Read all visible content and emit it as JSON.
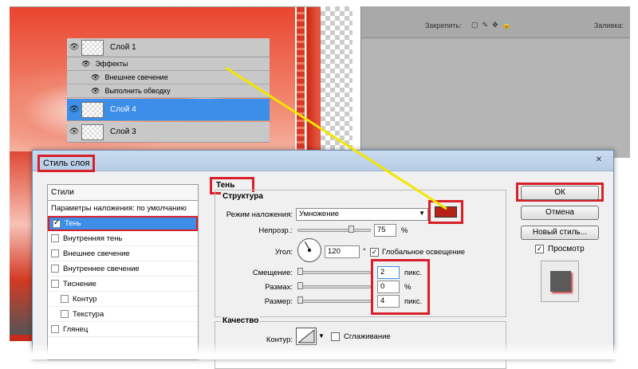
{
  "layers_panel": {
    "lock_label": "Закрепить:",
    "fill_label": "Заливка:",
    "layers": [
      {
        "name": "Слой 1",
        "visible": true
      },
      {
        "name": "Эффекты",
        "kind": "effects-header"
      },
      {
        "name": "Внешнее свечение",
        "kind": "effect"
      },
      {
        "name": "Выполнить обводку",
        "kind": "effect"
      },
      {
        "name": "Слой 4",
        "selected": true
      },
      {
        "name": "Слой 3"
      }
    ]
  },
  "dialog": {
    "title": "Стиль слоя",
    "close_glyph": "✕",
    "styles_list": {
      "header": "Стили",
      "blend_default": "Параметры наложения: по умолчанию",
      "items": [
        {
          "label": "Тень",
          "checked": true,
          "active": true
        },
        {
          "label": "Внутренняя тень",
          "checked": false
        },
        {
          "label": "Внешнее свечение",
          "checked": false
        },
        {
          "label": "Внутреннее свечение",
          "checked": false
        },
        {
          "label": "Тиснение",
          "checked": false
        },
        {
          "label": "Контур",
          "checked": false,
          "indent": true
        },
        {
          "label": "Текстура",
          "checked": false,
          "indent": true
        },
        {
          "label": "Глянец",
          "checked": false
        }
      ]
    },
    "shadow": {
      "section_title": "Тень",
      "structure_title": "Структура",
      "blend_mode_label": "Режим наложения:",
      "blend_mode_value": "Умножение",
      "shadow_color": "#b52218",
      "opacity_label": "Непрозр.:",
      "opacity_value": "75",
      "opacity_unit": "%",
      "angle_label": "Угол:",
      "angle_value": "120",
      "angle_unit": "°",
      "global_light_label": "Глобальное освещение",
      "global_light_checked": true,
      "distance_label": "Смещение:",
      "distance_value": "2",
      "distance_unit": "пикс.",
      "spread_label": "Размах:",
      "spread_value": "0",
      "spread_unit": "%",
      "size_label": "Размер:",
      "size_value": "4",
      "size_unit": "пикс.",
      "quality_title": "Качество",
      "contour_label": "Контур:",
      "antialias_label": "Сглаживание"
    },
    "buttons": {
      "ok": "ОК",
      "cancel": "Отмена",
      "new_style": "Новый стиль...",
      "preview_label": "Просмотр",
      "preview_checked": true
    }
  },
  "colors": {
    "highlight_red": "#d8202a",
    "selection_blue": "#3d8ee8",
    "annotation_yellow": "#f2e600"
  }
}
